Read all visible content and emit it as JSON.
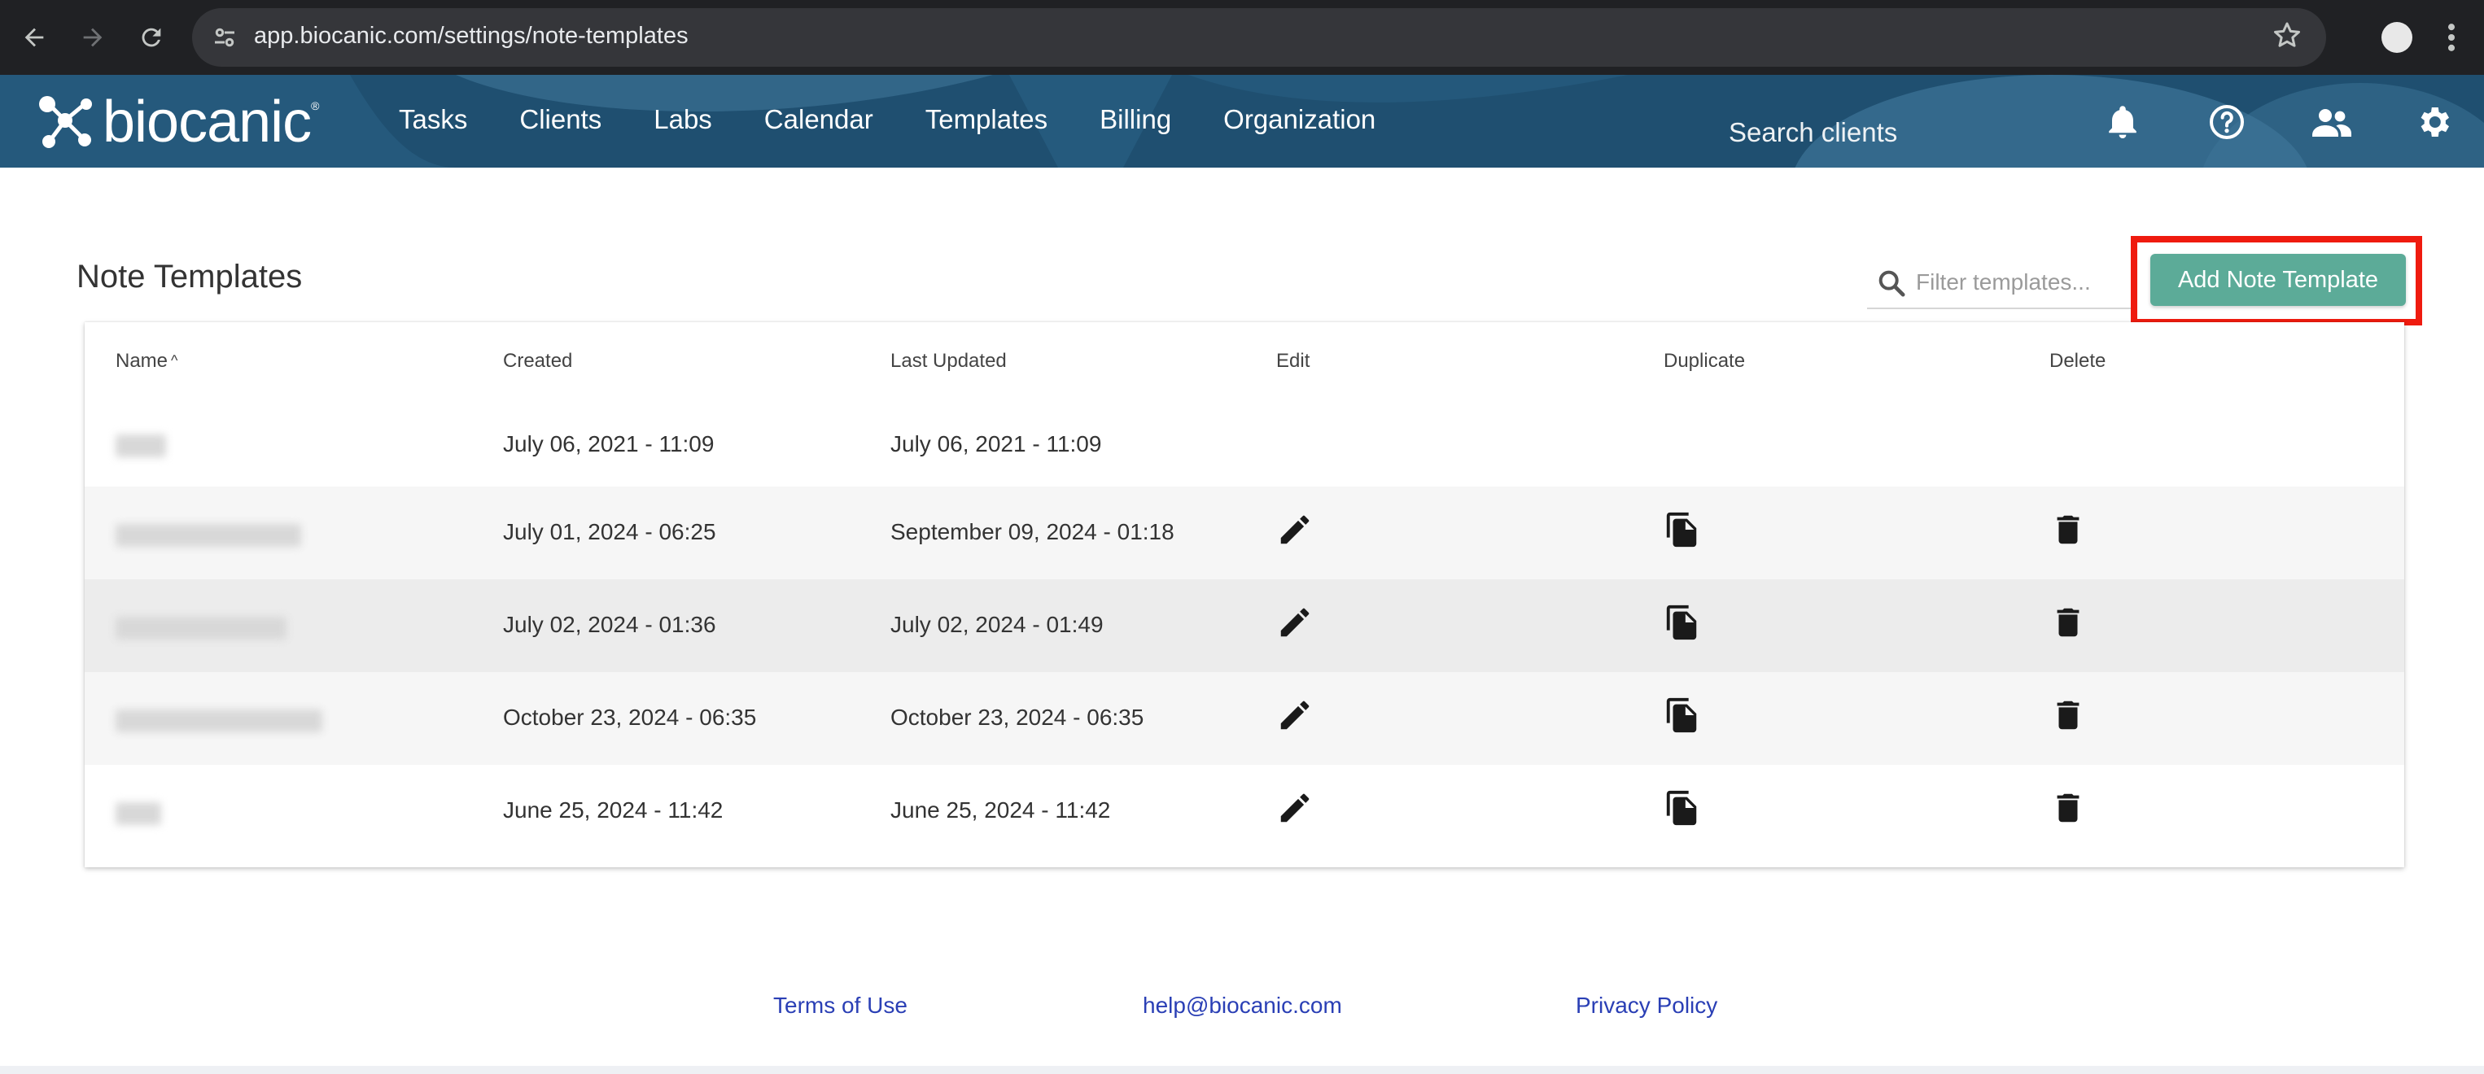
{
  "browser": {
    "url": "app.biocanic.com/settings/note-templates",
    "back_icon": "arrow-left-icon",
    "forward_icon": "arrow-right-icon",
    "reload_icon": "reload-icon",
    "site_info_icon": "tune-icon",
    "bookmark_icon": "star-icon",
    "menu_icon": "kebab-icon"
  },
  "header": {
    "brand": "biocanic",
    "brand_mark": "®",
    "nav": [
      "Tasks",
      "Clients",
      "Labs",
      "Calendar",
      "Templates",
      "Billing",
      "Organization"
    ],
    "search_placeholder": "Search clients",
    "icons": [
      "bell-icon",
      "help-icon",
      "people-icon",
      "gear-icon"
    ],
    "colors": {
      "bar": "#1f4f70",
      "accent": "#5cab98"
    }
  },
  "page": {
    "title": "Note Templates",
    "filter_placeholder": "Filter templates...",
    "add_button": "Add Note Template"
  },
  "table": {
    "columns": [
      "Name",
      "Created",
      "Last Updated",
      "Edit",
      "Duplicate",
      "Delete"
    ],
    "sort_indicator": "^",
    "rows": [
      {
        "name": "",
        "created": "July 06, 2021 - 11:09",
        "updated": "July 06, 2021 - 11:09",
        "actions": false
      },
      {
        "name": "",
        "created": "July 01, 2024 - 06:25",
        "updated": "September 09, 2024 - 01:18",
        "actions": true
      },
      {
        "name": "",
        "created": "July 02, 2024 - 01:36",
        "updated": "July 02, 2024 - 01:49",
        "actions": true
      },
      {
        "name": "",
        "created": "October 23, 2024 - 06:35",
        "updated": "October 23, 2024 - 06:35",
        "actions": true
      },
      {
        "name": "",
        "created": "June 25, 2024 - 11:42",
        "updated": "June 25, 2024 - 11:42",
        "actions": true
      }
    ]
  },
  "footer": {
    "terms": "Terms of Use",
    "email": "help@biocanic.com",
    "privacy": "Privacy Policy"
  }
}
